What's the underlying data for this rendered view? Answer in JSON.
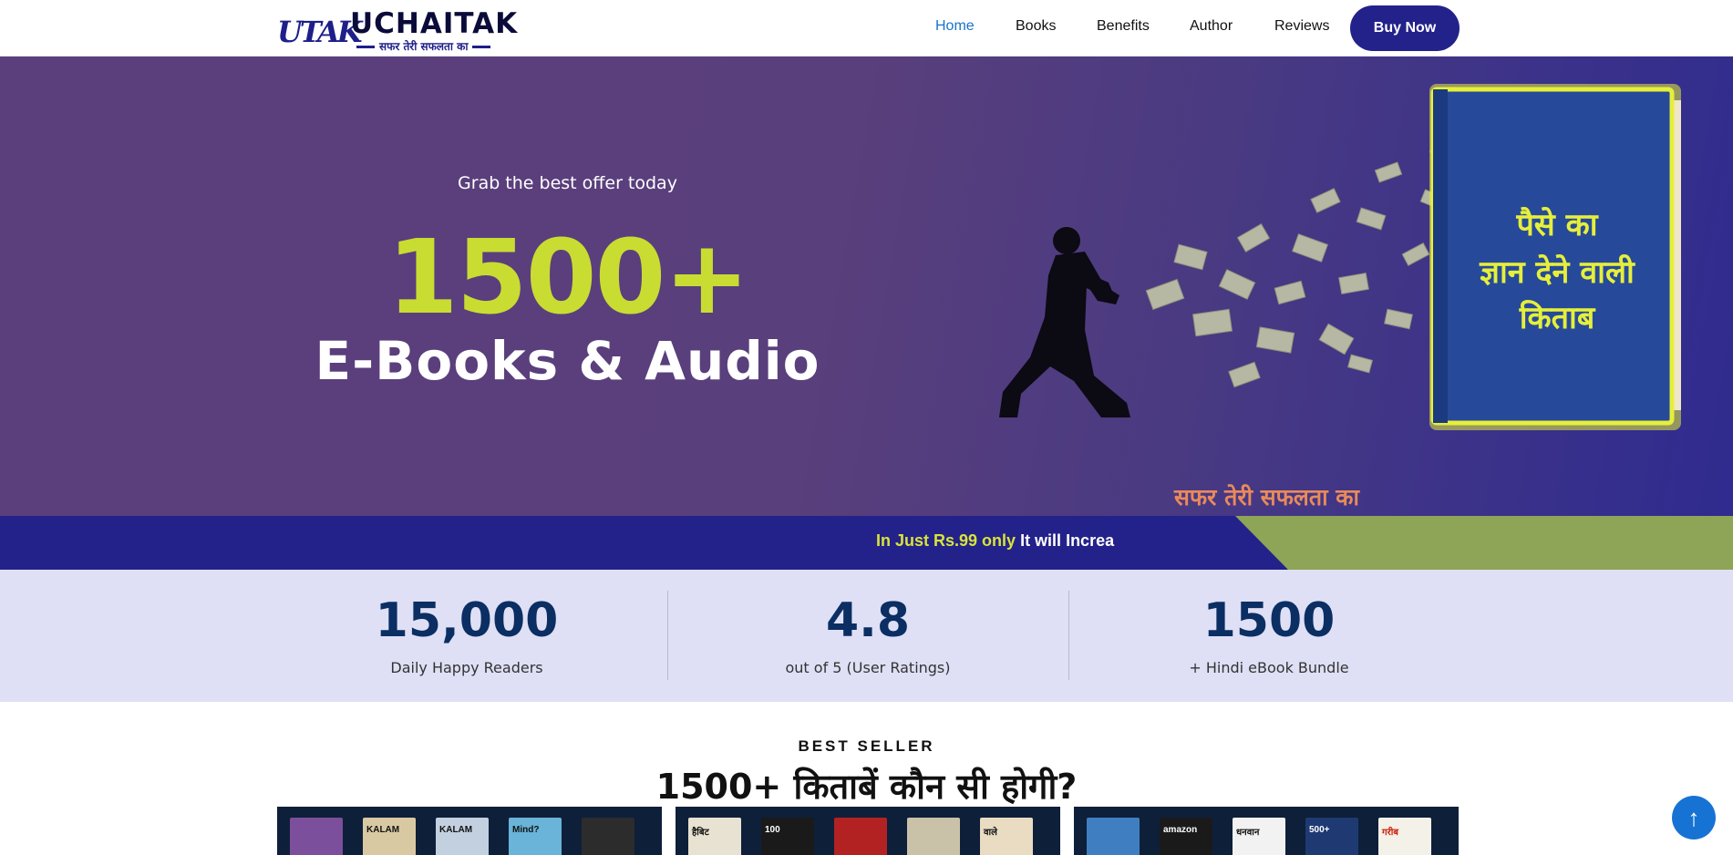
{
  "header": {
    "logo_mark": "UTAK",
    "logo_name": "UCHAITAK",
    "logo_tagline": "सफर तेरी सफलता का",
    "nav": [
      "Home",
      "Books",
      "Benefits",
      "Author",
      "Reviews"
    ],
    "active_nav": "Home",
    "buy_label": "Buy Now"
  },
  "hero": {
    "subtitle": "Grab the best offer today",
    "big_number": "1500+",
    "title": "E-Books & Audio",
    "book_text_1": "पैसे का",
    "book_text_2": "ज्ञान देने वाली",
    "book_text_3": "किताब",
    "tagline": "सफर तेरी सफलता का"
  },
  "strip": {
    "highlight": "In Just Rs.99 only",
    "rest": "It will Increa"
  },
  "stats": [
    {
      "value": "15,000",
      "label": "Daily Happy Readers"
    },
    {
      "value": "4.8",
      "label": "out of 5 (User Ratings)"
    },
    {
      "value": "1500",
      "label": "+ Hindi eBook Bundle"
    }
  ],
  "bestseller": {
    "kicker": "BEST SELLER",
    "title": "1500+ किताबें कौन सी होगी?",
    "panel1_books": [
      "",
      "KALAM",
      "KALAM",
      "Mind?",
      ""
    ],
    "panel2_books": [
      "हैबिट",
      "100",
      "",
      "",
      "वाले"
    ],
    "panel3_books": [
      "",
      "amazon",
      "धनवान",
      "500+",
      "गरीब"
    ]
  },
  "colors": {
    "brand": "#23228a",
    "accent": "#c9dc32",
    "link_active": "#1a73c8",
    "stats_bg": "#dfe0f5"
  },
  "icons": {
    "scroll_top": "arrow-up-icon"
  }
}
